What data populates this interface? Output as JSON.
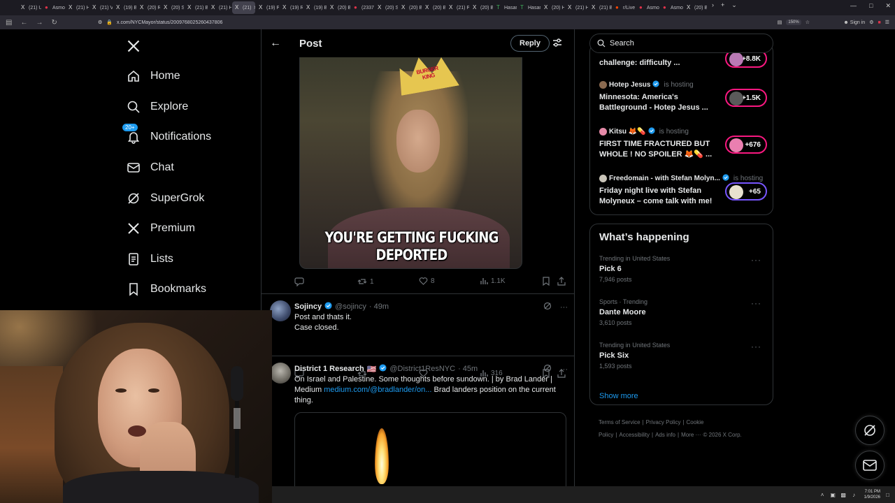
{
  "browser": {
    "tabs": [
      {
        "label": "(21) U",
        "icon": "x-logo"
      },
      {
        "label": "Asmo",
        "icon": "asmongold-favicon"
      },
      {
        "label": "(21) H",
        "icon": "x-logo"
      },
      {
        "label": "(21) V",
        "icon": "x-logo"
      },
      {
        "label": "(19) B",
        "icon": "x-logo"
      },
      {
        "label": "(20) R",
        "icon": "x-logo"
      },
      {
        "label": "(20) S",
        "icon": "x-logo"
      },
      {
        "label": "(21) B",
        "icon": "x-logo"
      },
      {
        "label": "(21) H",
        "icon": "x-logo"
      },
      {
        "label": "(21)",
        "icon": "x-logo",
        "active": true
      },
      {
        "label": "(19) P",
        "icon": "x-logo"
      },
      {
        "label": "(19) R",
        "icon": "x-logo"
      },
      {
        "label": "(19) B",
        "icon": "x-logo"
      },
      {
        "label": "(20) B",
        "icon": "x-logo"
      },
      {
        "label": "(2337",
        "icon": "red-favicon"
      },
      {
        "label": "(20) S",
        "icon": "x-logo"
      },
      {
        "label": "(20) B",
        "icon": "x-logo"
      },
      {
        "label": "(20) B",
        "icon": "x-logo"
      },
      {
        "label": "(21) P",
        "icon": "x-logo"
      },
      {
        "label": "(20) B",
        "icon": "x-logo"
      },
      {
        "label": "Hasan",
        "icon": "green-favicon"
      },
      {
        "label": "Hasan",
        "icon": "green-favicon"
      },
      {
        "label": "(20) H",
        "icon": "x-logo"
      },
      {
        "label": "(21) H",
        "icon": "x-logo"
      },
      {
        "label": "(21) B",
        "icon": "x-logo"
      },
      {
        "label": "r/Live",
        "icon": "reddit-favicon"
      },
      {
        "label": "Asmo",
        "icon": "asmongold-favicon"
      },
      {
        "label": "Asmo",
        "icon": "asmongold-favicon"
      },
      {
        "label": "(20) B",
        "icon": "x-logo"
      }
    ],
    "url": "x.com/NYCMayor/status/2009768025260437806",
    "zoom": "150%",
    "signin_label": "Sign in"
  },
  "sidebar": {
    "items": [
      {
        "label": "Home",
        "icon": "home-icon"
      },
      {
        "label": "Explore",
        "icon": "search-icon"
      },
      {
        "label": "Notifications",
        "icon": "bell-icon",
        "badge": "20+"
      },
      {
        "label": "Chat",
        "icon": "mail-icon"
      },
      {
        "label": "SuperGrok",
        "icon": "grok-icon"
      },
      {
        "label": "Premium",
        "icon": "x-icon"
      },
      {
        "label": "Lists",
        "icon": "list-icon"
      },
      {
        "label": "Bookmarks",
        "icon": "bookmark-icon"
      }
    ]
  },
  "main": {
    "header_title": "Post",
    "reply_label": "Reply",
    "image_caption": "YOU'RE GETTING FUCKING DEPORTED",
    "image_crown_text": "BURGER KING",
    "post_actions": {
      "reposts": "1",
      "likes": "8",
      "views": "1.1K"
    },
    "tweets": [
      {
        "name": "Sojincy",
        "handle": "@sojincy",
        "time": "· 49m",
        "lines": [
          "Post and thats it.",
          "Case closed."
        ],
        "views": "316"
      },
      {
        "name": "District 1 Research",
        "flag": "🇺🇸",
        "handle": "@District1ResNYC",
        "time": "· 45m",
        "text_part1": "On Israel and Palestine. Some thoughts before sundown. | by Brad Lander | Medium",
        "link": "medium.com/@bradlander/on...",
        "text_part2": "Brad landers position on the current thing."
      }
    ]
  },
  "right": {
    "search_placeholder": "Search",
    "spaces": [
      {
        "host": "",
        "state": "",
        "title": "challenge: difficulty ...",
        "listeners": "+8.8K",
        "ring_color": "#f91880"
      },
      {
        "host": "Hotep Jesus",
        "state": "is hosting",
        "title": "Minnesota: America's Battleground - Hotep Jesus ...",
        "listeners": "+1.5K",
        "ring_color": "#f91880"
      },
      {
        "host": "Kitsu 🦊💊",
        "state": "is hosting",
        "title": "FIRST TIME FRACTURED BUT WHOLE ! NO SPOILER 🦊💊 ...",
        "listeners": "+676",
        "ring_color": "#f91880"
      },
      {
        "host": "Freedomain - with Stefan Molyn...",
        "state": "is hosting",
        "title": "Friday night live with Stefan Molyneux – come talk with me!",
        "listeners": "+65",
        "ring_color": "#7856ff"
      }
    ],
    "happening_title": "What’s happening",
    "trends": [
      {
        "context": "Trending in United States",
        "name": "Pick 6",
        "count": "7,946 posts"
      },
      {
        "context": "Sports · Trending",
        "name": "Dante Moore",
        "count": "3,610 posts"
      },
      {
        "context": "Trending in United States",
        "name": "Pick Six",
        "count": "1,593 posts"
      }
    ],
    "show_more": "Show more",
    "footer": [
      "Terms of Service",
      "|",
      "Privacy Policy",
      "|",
      "Cookie Policy",
      "|",
      "Accessibility",
      "|",
      "Ads info",
      "|",
      "More ···",
      "© 2026 X Corp."
    ]
  },
  "taskbar": {
    "time": "7:01 PM",
    "date": "1/9/2026"
  },
  "colors": {
    "accent": "#1d9bf0",
    "border": "#2f3336",
    "muted": "#71767b",
    "text": "#e7e9ea",
    "spaces_pink": "#f91880",
    "spaces_purple": "#7856ff"
  }
}
